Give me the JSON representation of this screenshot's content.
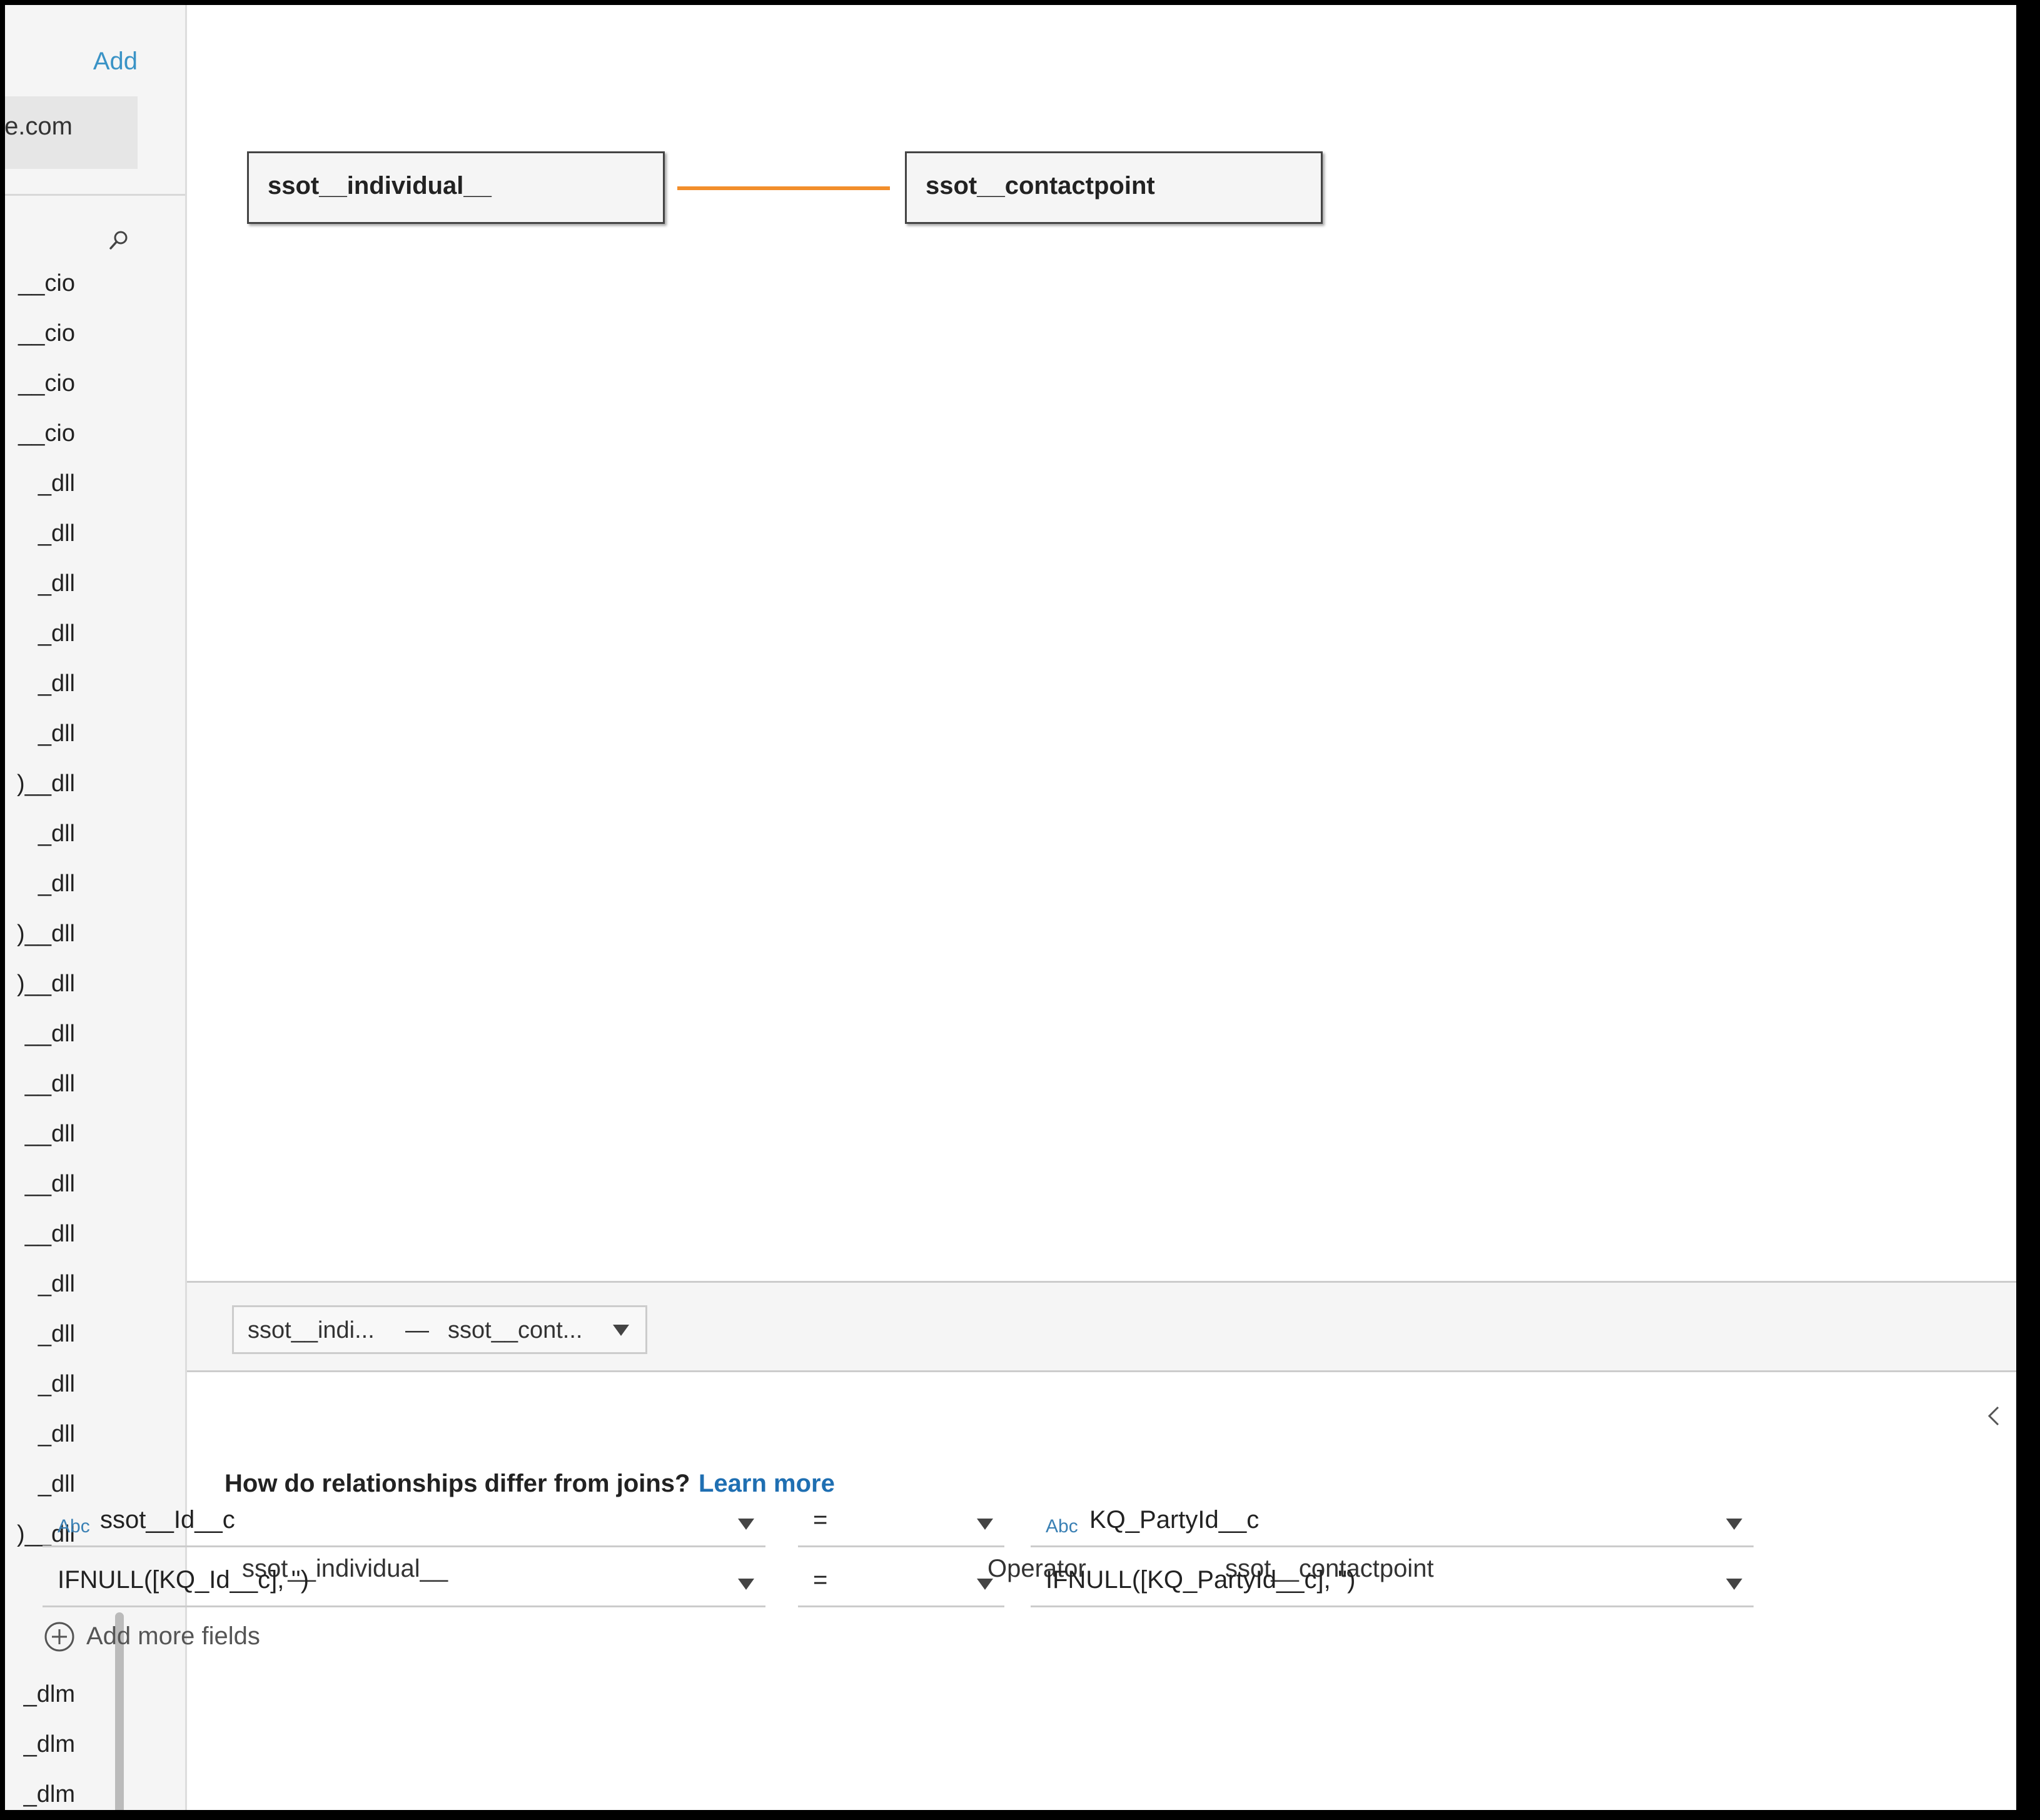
{
  "left_panel": {
    "add_label": "Add",
    "connection_label": "e.com",
    "tables": [
      "__cio",
      "__cio",
      "__cio",
      "__cio",
      "_dll",
      "_dll",
      "_dll",
      "_dll",
      "_dll",
      "_dll",
      ")__dll",
      "_dll",
      "_dll",
      ")__dll",
      ")__dll",
      "__dll",
      "__dll",
      "__dll",
      "__dll",
      "__dll",
      "_dll",
      "_dll",
      "_dll",
      "_dll",
      "_dll",
      ")__dll"
    ],
    "tables_lower": [
      "_dlm",
      "_dlm",
      "_dlm"
    ]
  },
  "canvas": {
    "left_table": "ssot__individual__",
    "right_table": "ssot__contactpoint",
    "relationship_color": "#f28e2b"
  },
  "relationship_bar": {
    "left": "ssot__indi...",
    "separator": "—",
    "right": "ssot__cont..."
  },
  "details": {
    "question": "How do relationships differ from joins?",
    "learn_more": "Learn more",
    "header_left": "ssot__individual__",
    "header_operator": "Operator",
    "header_right": "ssot__contactpoint",
    "type_abc": "Abc",
    "rows": [
      {
        "left": "ssot__Id__c",
        "operator": "=",
        "right": "KQ_PartyId__c"
      },
      {
        "left": "IFNULL([KQ_Id__c], '')",
        "operator": "=",
        "right": "IFNULL([KQ_PartyId__c], '')"
      }
    ],
    "add_more_fields": "Add more fields"
  }
}
